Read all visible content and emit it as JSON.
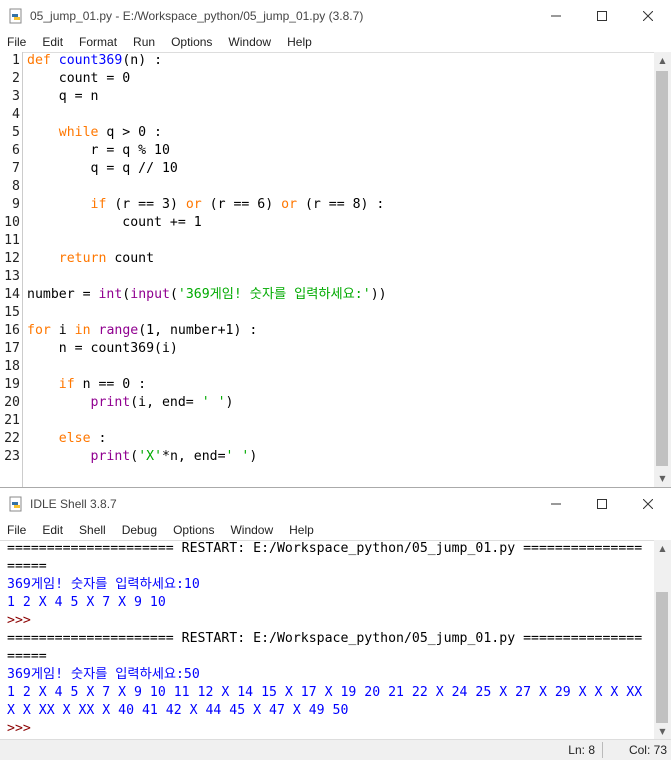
{
  "editor": {
    "title": "05_jump_01.py - E:/Workspace_python/05_jump_01.py (3.8.7)",
    "menu": [
      "File",
      "Edit",
      "Format",
      "Run",
      "Options",
      "Window",
      "Help"
    ],
    "line_numbers": [
      "1",
      "2",
      "3",
      "4",
      "5",
      "6",
      "7",
      "8",
      "9",
      "10",
      "11",
      "12",
      "13",
      "14",
      "15",
      "16",
      "17",
      "18",
      "19",
      "20",
      "21",
      "22",
      "23"
    ],
    "code_lines": [
      "def count369(n) :",
      "    count = 0",
      "    q = n",
      "",
      "    while q > 0 :",
      "        r = q % 10",
      "        q = q // 10",
      "",
      "        if (r == 3) or (r == 6) or (r == 8) :",
      "            count += 1",
      "",
      "    return count",
      "",
      "number = int(input('369게임! 숫자를 입력하세요:'))",
      "",
      "for i in range(1, number+1) :",
      "    n = count369(i)",
      "",
      "    if n == 0 :",
      "        print(i, end= ' ')",
      "",
      "    else :",
      "        print('X'*n, end=' ')"
    ]
  },
  "shell": {
    "title": "IDLE Shell 3.8.7",
    "menu": [
      "File",
      "Edit",
      "Shell",
      "Debug",
      "Options",
      "Window",
      "Help"
    ],
    "lines": [
      {
        "kind": "plain",
        "text": "===================== RESTART: E:/Workspace_python/05_jump_01.py ==============="
      },
      {
        "kind": "plain",
        "text": "====="
      },
      {
        "kind": "out",
        "text": "369게임! 숫자를 입력하세요:10"
      },
      {
        "kind": "out",
        "text": "1 2 X 4 5 X 7 X 9 10"
      },
      {
        "kind": "prompt",
        "text": ">>>"
      },
      {
        "kind": "plain",
        "text": "===================== RESTART: E:/Workspace_python/05_jump_01.py ==============="
      },
      {
        "kind": "plain",
        "text": "====="
      },
      {
        "kind": "out",
        "text": "369게임! 숫자를 입력하세요:50"
      },
      {
        "kind": "out",
        "text": "1 2 X 4 5 X 7 X 9 10 11 12 X 14 15 X 17 X 19 20 21 22 X 24 25 X 27 X 29 X X X XX"
      },
      {
        "kind": "out",
        "text": "X X XX X XX X 40 41 42 X 44 45 X 47 X 49 50"
      },
      {
        "kind": "prompt",
        "text": ">>>"
      }
    ],
    "status": {
      "ln": "Ln: 8",
      "col": "Col: 73"
    }
  },
  "colors": {
    "keyword": "#ff7700",
    "builtin": "#900090",
    "def_name": "#0000ff",
    "string": "#00aa00",
    "output": "#0000ff",
    "prompt": "#8b0000"
  }
}
